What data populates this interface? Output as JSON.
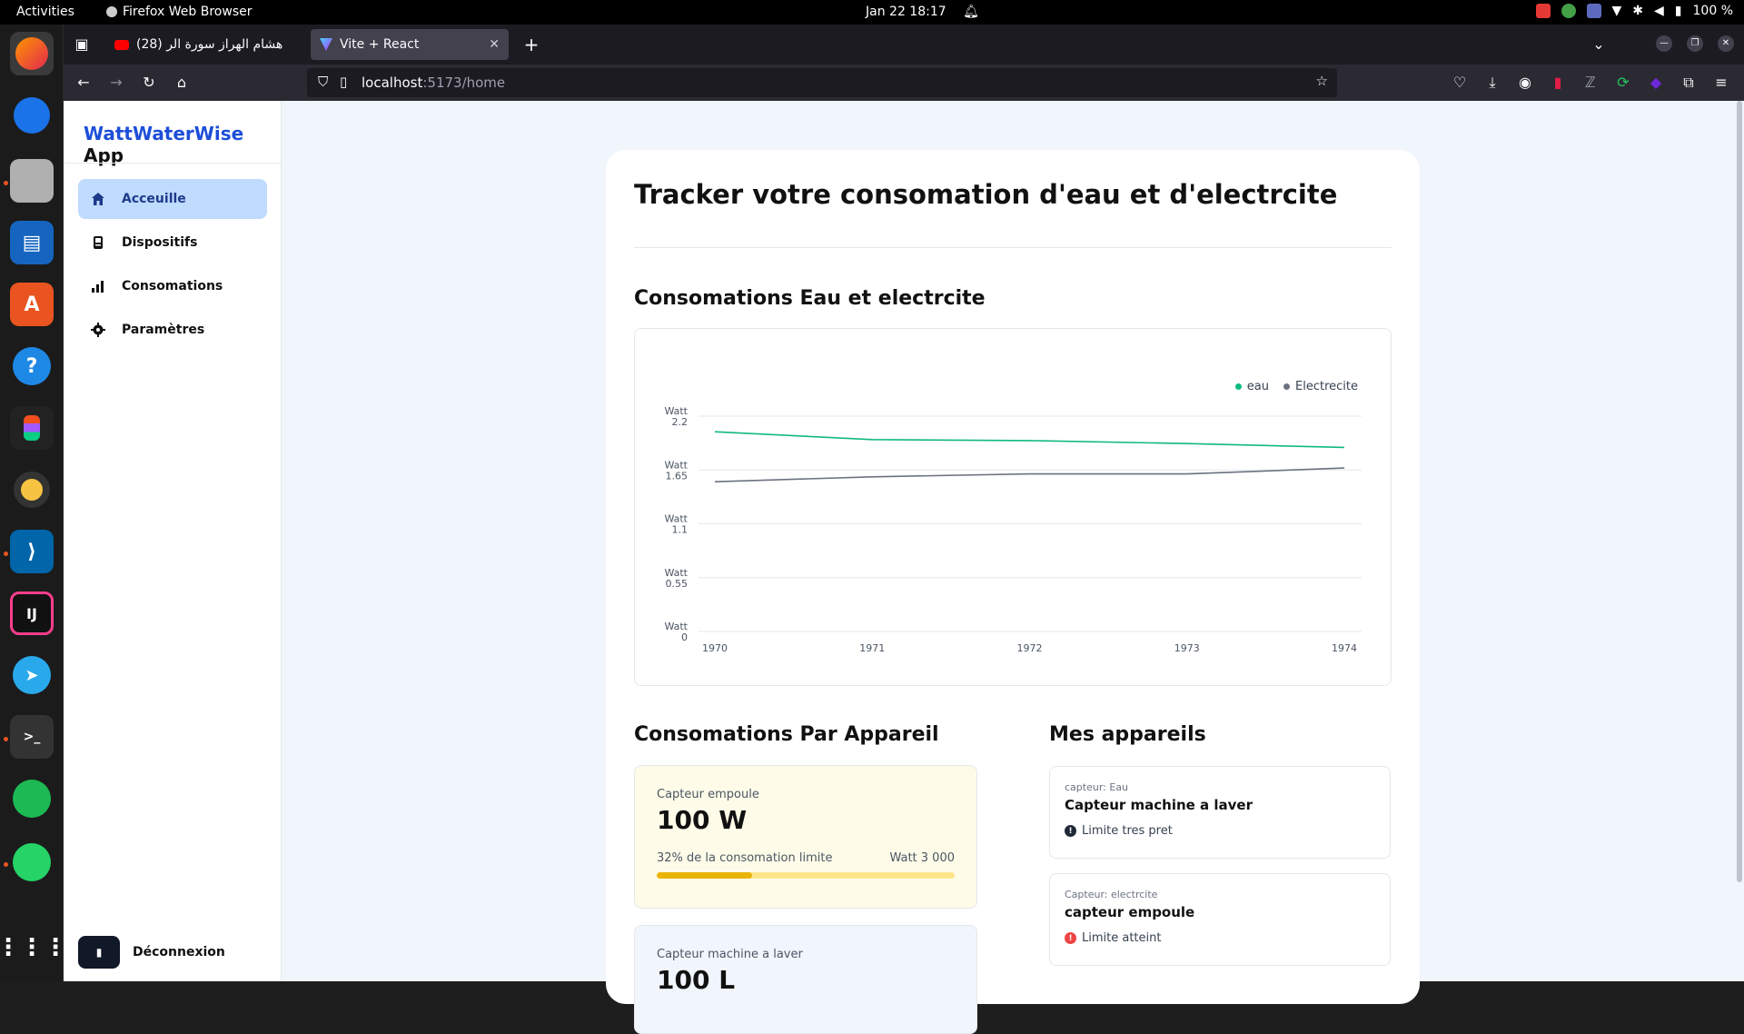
{
  "system": {
    "activities": "Activities",
    "app_name": "Firefox Web Browser",
    "clock": "Jan 22  18:17",
    "battery": "100 %"
  },
  "browser": {
    "tabs": [
      {
        "label": "(28) هشام الهراز سورة الر"
      },
      {
        "label": "Vite + React"
      }
    ],
    "url_host": "localhost",
    "url_path": ":5173/home"
  },
  "app": {
    "brand": "WattWaterWise",
    "brand_suffix": " App",
    "menu": [
      {
        "label": "Acceuille",
        "icon": "home-icon"
      },
      {
        "label": "Dispositifs",
        "icon": "device-icon"
      },
      {
        "label": "Consomations",
        "icon": "bar-chart-icon"
      },
      {
        "label": "Paramètres",
        "icon": "gear-icon"
      }
    ],
    "logout": "Déconnexion"
  },
  "main": {
    "title": "Tracker votre consomation d'eau et d'electrcite",
    "chart_heading": "Consomations Eau et electrcite",
    "per_device_heading": "Consomations Par Appareil",
    "my_devices_heading": "Mes appareils"
  },
  "chart_data": {
    "type": "line",
    "categories": [
      "1970",
      "1971",
      "1972",
      "1973",
      "1974"
    ],
    "y_ticks": [
      {
        "label": "Watt",
        "value": "2.2"
      },
      {
        "label": "Watt",
        "value": "1.65"
      },
      {
        "label": "Watt",
        "value": "1.1"
      },
      {
        "label": "Watt",
        "value": "0.55"
      },
      {
        "label": "Watt",
        "value": "0"
      }
    ],
    "ylim": [
      0,
      2.2
    ],
    "series": [
      {
        "name": "eau",
        "color": "#10b981",
        "values": [
          2.04,
          1.96,
          1.95,
          1.92,
          1.88
        ]
      },
      {
        "name": "Electrecite",
        "color": "#6b7280",
        "values": [
          1.53,
          1.58,
          1.61,
          1.61,
          1.67
        ]
      }
    ],
    "legend": "top-right",
    "grid": true
  },
  "usage_cards": [
    {
      "label": "Capteur empoule",
      "value": "100 W",
      "percent_text": "32% de la consomation limite",
      "limit": "Watt 3 000",
      "progress": 0.32,
      "bg": "#fefce8"
    },
    {
      "label": "Capteur machine a laver",
      "value": "100 L",
      "bg": "#f1f5fc"
    }
  ],
  "devices": [
    {
      "type": "capteur: Eau",
      "name": "Capteur machine a laver",
      "status": "Limite tres pret",
      "status_color": "#1f2937"
    },
    {
      "type": "Capteur: electrcite",
      "name": "capteur empoule",
      "status": "Limite atteint",
      "status_color": "#ef4444"
    }
  ]
}
